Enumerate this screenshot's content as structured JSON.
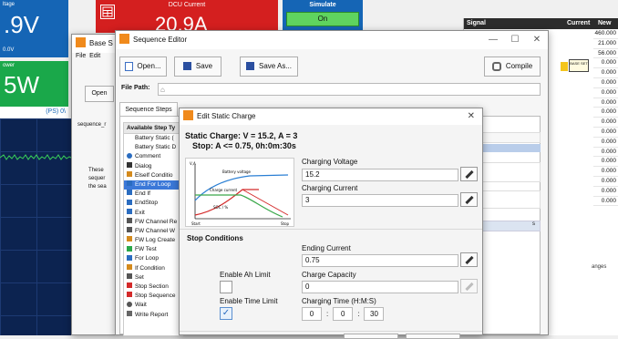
{
  "dashboard": {
    "voltage_tile_label": "ltage",
    "voltage_value": ".9V",
    "voltage_sub": "0.0V",
    "power_tile_label": "ower",
    "power_value": "5W",
    "dcu_current_label": "DCU Current",
    "dcu_current_value": "20.9A",
    "simulate_label": "Simulate",
    "simulate_state": "On",
    "ps_label": "(PS)",
    "ps_suffix": "0\\",
    "signal_header": "Signal",
    "current_header": "Current",
    "new_header": "New",
    "values_col": [
      "460.000",
      "21.000",
      "56.000",
      "0.000",
      "0.000",
      "0.000",
      "0.000",
      "0.000",
      "0.000",
      "0.000",
      "0.000",
      "0.000",
      "0.000",
      "0.000",
      "0.000",
      "0.000",
      "0.000",
      "0.000"
    ],
    "tiny_btn_label": "BASE SET",
    "ranges_label": "anges",
    "s_label": "s"
  },
  "base_window": {
    "title": "Base S",
    "menu": [
      "File",
      "Edit"
    ],
    "open_label": "Open",
    "sequence_label": "sequence_r",
    "body_text": [
      "These",
      "sequer",
      "the sea"
    ]
  },
  "sequence_editor": {
    "title": "Sequence Editor",
    "open_label": "Open...",
    "save_label": "Save",
    "save_as_label": "Save As...",
    "compile_label": "Compile",
    "file_path_label": "File Path:",
    "file_path_value": "",
    "tab_sequence_steps": "Sequence Steps",
    "available_steps_header": "Available Step Ty",
    "steps": [
      {
        "label": "Battery Static (",
        "icon": "none"
      },
      {
        "label": "Battery Static D",
        "icon": "none"
      },
      {
        "label": "Comment",
        "icon": "info-icon"
      },
      {
        "label": "Dialog",
        "icon": "dialog-icon"
      },
      {
        "label": "Elself Conditio",
        "icon": "branch-icon"
      },
      {
        "label": "End For Loop",
        "icon": "loop-end-icon",
        "selected": true
      },
      {
        "label": "End If",
        "icon": "arrow-icon"
      },
      {
        "label": "EndStop",
        "icon": "arrow-icon"
      },
      {
        "label": "Exit",
        "icon": "arrow-icon"
      },
      {
        "label": "FW Channel Re",
        "icon": "channel-icon"
      },
      {
        "label": "FW Channel W",
        "icon": "channel-icon"
      },
      {
        "label": "FW Log Create",
        "icon": "log-icon"
      },
      {
        "label": "FW Test",
        "icon": "play-icon"
      },
      {
        "label": "For Loop",
        "icon": "loop-icon"
      },
      {
        "label": "If Condition",
        "icon": "branch-icon"
      },
      {
        "label": "Set",
        "icon": "set-icon"
      },
      {
        "label": "Stop Section",
        "icon": "stop-icon"
      },
      {
        "label": "Stop Sequence",
        "icon": "stop-icon"
      },
      {
        "label": "Wait",
        "icon": "clock-icon"
      },
      {
        "label": "Write Report",
        "icon": "report-icon"
      }
    ]
  },
  "static_charge_dialog": {
    "title": "Edit Static Charge",
    "summary_line1": "Static Charge: V = 15.2, A = 3",
    "summary_line2": "Stop: A <= 0.75, 0h:0m:30s",
    "graph_labels": {
      "y_axis": "V,A",
      "battery_voltage": "Battery voltage",
      "charge_current": "Charge current",
      "soc": "SOC / %",
      "start": "Start",
      "stop": "Stop"
    },
    "charging_voltage_label": "Charging Voltage",
    "charging_voltage_value": "15.2",
    "charging_current_label": "Charging Current",
    "charging_current_value": "3",
    "stop_conditions_label": "Stop Conditions",
    "ending_current_label": "Ending Current",
    "ending_current_value": "0.75",
    "enable_ah_limit_label": "Enable Ah Limit",
    "enable_ah_limit_checked": false,
    "charge_capacity_label": "Charge Capacity",
    "charge_capacity_value": "0",
    "enable_time_limit_label": "Enable Time Limit",
    "enable_time_limit_checked": true,
    "charging_time_label": "Charging Time (H:M:S)",
    "time_hours": "0",
    "time_minutes": "0",
    "time_seconds": "30",
    "time_sep": ":"
  }
}
